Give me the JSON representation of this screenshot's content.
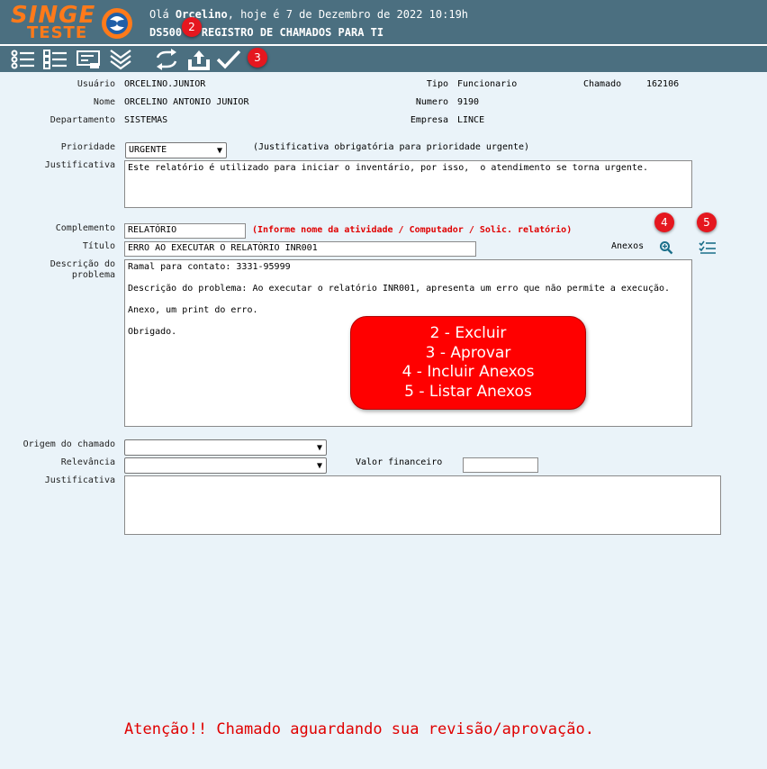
{
  "brand": {
    "logo_top": "SINGE",
    "logo_bottom": "TESTE"
  },
  "header": {
    "greeting_prefix": "Olá ",
    "user_first_name": "Orcelino",
    "greeting_suffix": ", hoje é 7 de Dezembro de 2022 10:19h",
    "module_title": "DS500 - REGISTRO DE CHAMADOS PARA TI"
  },
  "toolbar": {
    "icons": [
      "list-icon",
      "checklist-icon",
      "form-icon",
      "double-chevron-down-icon",
      "refresh-icon",
      "upload-icon",
      "checkmark-icon"
    ],
    "badges": [
      "2",
      "3"
    ]
  },
  "info": {
    "usuario_label": "Usuário",
    "usuario_value": "ORCELINO.JUNIOR",
    "nome_label": "Nome",
    "nome_value": "ORCELINO ANTONIO JUNIOR",
    "departamento_label": "Departamento",
    "departamento_value": "SISTEMAS",
    "tipo_label": "Tipo",
    "tipo_value": "Funcionario",
    "numero_label": "Numero",
    "numero_value": "9190",
    "empresa_label": "Empresa",
    "empresa_value": "LINCE",
    "chamado_label": "Chamado",
    "chamado_value": "162106"
  },
  "form": {
    "prioridade_label": "Prioridade",
    "prioridade_value": "URGENTE",
    "prioridade_hint": "(Justificativa obrigatória para prioridade urgente)",
    "justificativa_label": "Justificativa",
    "justificativa_value": "Este relatório é utilizado para iniciar o inventário, por isso,  o atendimento se torna urgente.",
    "complemento_label": "Complemento",
    "complemento_value": "RELATÓRIO",
    "complemento_hint": "(Informe nome da atividade / Computador / Solic. relatório)",
    "titulo_label": "Título",
    "titulo_value": "ERRO AO EXECUTAR O RELATÓRIO INR001",
    "anexos_label": "Anexos",
    "anexos_badges": [
      "4",
      "5"
    ],
    "descricao_label_1": "Descrição do",
    "descricao_label_2": "problema",
    "descricao_value": "Ramal para contato: 3331-95999\n\nDescrição do problema: Ao executar o relatório INR001, apresenta um erro que não permite a execução.\n\nAnexo, um print do erro.\n\nObrigado.",
    "origem_label": "Origem do chamado",
    "origem_value": "",
    "relevancia_label": "Relevância",
    "relevancia_value": "",
    "valor_label": "Valor financeiro",
    "valor_value": "",
    "justificativa2_label": "Justificativa",
    "justificativa2_value": ""
  },
  "callout": {
    "line1": "2 - Excluir",
    "line2": "3 - Aprovar",
    "line3": "4 - Incluir Anexos",
    "line4": "5 - Listar Anexos"
  },
  "warning": "Atenção!! Chamado aguardando sua revisão/aprovação.",
  "colors": {
    "header_bg": "#4b6f80",
    "page_bg": "#eaf3f9",
    "accent_red": "#e00000",
    "logo_orange": "#ff7a1a"
  }
}
